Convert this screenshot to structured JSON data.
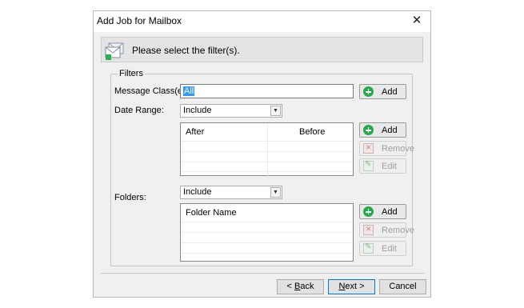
{
  "window": {
    "title": "Add Job for Mailbox"
  },
  "header": {
    "text": "Please select the filter(s)."
  },
  "filters": {
    "legend": "Filters",
    "message_class": {
      "label": "Message Class(es):",
      "value": "All",
      "add_label": "Add"
    },
    "date_range": {
      "label": "Date Range:",
      "selected": "Include",
      "columns": [
        "After",
        "Before"
      ],
      "buttons": {
        "add": "Add",
        "remove": "Remove",
        "edit": "Edit"
      }
    },
    "folders": {
      "label": "Folders:",
      "selected": "Include",
      "columns": [
        "Folder Name"
      ],
      "buttons": {
        "add": "Add",
        "remove": "Remove",
        "edit": "Edit"
      }
    }
  },
  "footer": {
    "back": {
      "prefix": "< ",
      "accel": "B",
      "rest": "ack"
    },
    "next": {
      "accel": "N",
      "rest": "ext >"
    },
    "cancel": "Cancel"
  },
  "colors": {
    "accent": "#0078d7",
    "selection": "#3399ff",
    "add_icon": "#27a84a"
  },
  "icons": [
    "close-icon",
    "mailbox-filter-icon",
    "add-icon",
    "remove-icon",
    "edit-icon",
    "chevron-down-icon"
  ]
}
